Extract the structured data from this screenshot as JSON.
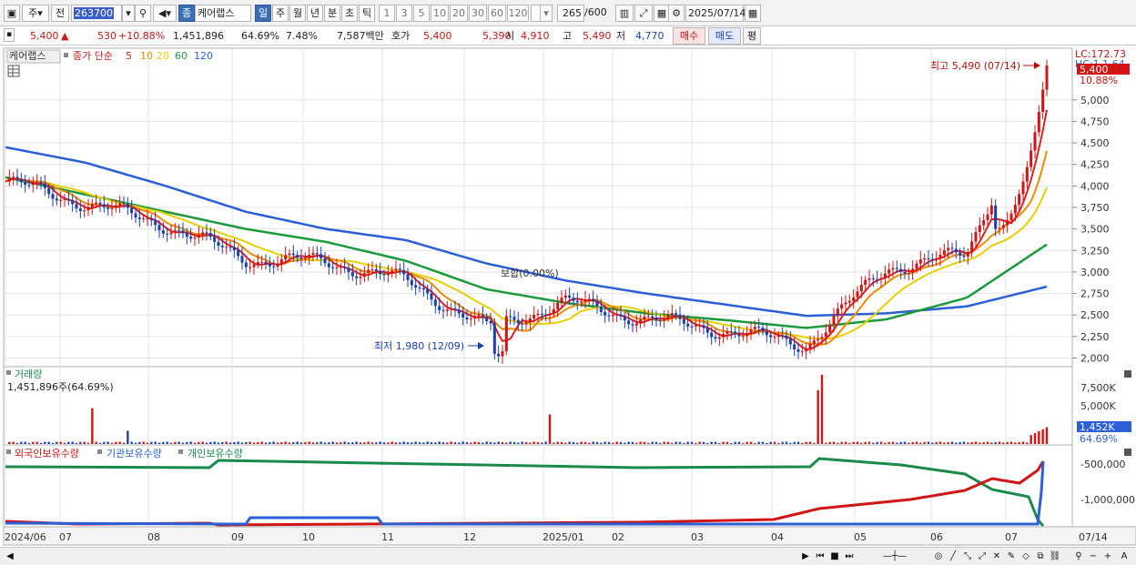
{
  "toolbar": {
    "market": "주",
    "prev_label": "전",
    "code": "263700",
    "name_badge": "종",
    "stock_name": "케어랩스",
    "period_tabs": [
      "일",
      "주",
      "월",
      "년",
      "분",
      "초",
      "틱"
    ],
    "active_period": "일",
    "intervals": [
      "1",
      "3",
      "5",
      "10",
      "20",
      "30",
      "60",
      "120"
    ],
    "count": "265",
    "total": "/600",
    "date": "2025/07/14"
  },
  "quote": {
    "price": "5,400",
    "change": "530",
    "change_pct": "+10.88%",
    "volume": "1,451,896",
    "vol_ratio": "64.69%",
    "turnover": "7.48%",
    "amount": "7,587백만",
    "bid_label": "호가",
    "bid": "5,400",
    "ask": "5,390",
    "open_label": "시",
    "open": "4,910",
    "high_label": "고",
    "high": "5,490",
    "low_label": "저",
    "low": "4,770",
    "buy_label": "매수",
    "sell_label": "매도",
    "eval_label": "평"
  },
  "legend": {
    "name": "케어랩스",
    "ma_label": "종가 단순",
    "ma": [
      {
        "label": "5",
        "color": "#e02020"
      },
      {
        "label": "10",
        "color": "#f08a00"
      },
      {
        "label": "20",
        "color": "#e6d000"
      },
      {
        "label": "60",
        "color": "#1a9a3a"
      },
      {
        "label": "120",
        "color": "#2a5fd8"
      }
    ]
  },
  "price_axis": {
    "ticks": [
      "5,000",
      "4,750",
      "4,500",
      "4,250",
      "4,000",
      "3,750",
      "3,500",
      "3,250",
      "3,000",
      "2,750",
      "2,500",
      "2,250",
      "2,000"
    ],
    "lc": "LC:172.73",
    "hc": "HC:1.1.64",
    "last": "5,400",
    "last_pct": "10.88%"
  },
  "annotations": {
    "high": "최고 5,490 (07/14)",
    "low": "최저 1,980 (12/09)",
    "flat": "보합(0.00%)"
  },
  "volume_pane": {
    "title": "거래량",
    "value": "1,451,896주(64.69%)",
    "ticks": [
      "7,500K",
      "5,000K"
    ],
    "last": "1,452K",
    "last_pct": "64.69%"
  },
  "holding_pane": {
    "series": [
      {
        "label": "외국인보유수량",
        "color": "#d11414"
      },
      {
        "label": "기관보유수량",
        "color": "#2a5fd8"
      },
      {
        "label": "개인보유수량",
        "color": "#1a8a4a"
      }
    ],
    "ticks": [
      "-500,000",
      "-1,000,000"
    ]
  },
  "x_axis": {
    "labels": [
      "2024/06",
      "07",
      "08",
      "09",
      "10",
      "11",
      "12",
      "2025/01",
      "02",
      "03",
      "04",
      "05",
      "06",
      "07"
    ],
    "end": "07/14"
  },
  "chart_data": {
    "type": "line",
    "title": "케어랩스",
    "x": [
      "2024/06",
      "2024/07",
      "2024/08",
      "2024/09",
      "2024/10",
      "2024/11",
      "2024/12",
      "2025/01",
      "2025/02",
      "2025/03",
      "2025/04",
      "2025/05",
      "2025/06",
      "2025/07"
    ],
    "series": [
      {
        "name": "종가",
        "values": [
          4050,
          3800,
          3550,
          3150,
          3120,
          2900,
          2350,
          2650,
          2450,
          2320,
          2150,
          3050,
          3200,
          5400
        ]
      },
      {
        "name": "120",
        "values": [
          4450,
          4270,
          4000,
          3700,
          3500,
          3370,
          3100,
          2900,
          2750,
          2620,
          2490,
          2520,
          2600,
          2830
        ]
      },
      {
        "name": "60",
        "values": [
          4100,
          3900,
          3700,
          3500,
          3350,
          3130,
          2800,
          2640,
          2520,
          2440,
          2350,
          2450,
          2700,
          3320
        ]
      }
    ],
    "ylim": [
      1900,
      5600
    ],
    "high": {
      "value": 5490,
      "date": "07/14"
    },
    "low": {
      "value": 1980,
      "date": "12/09"
    }
  }
}
